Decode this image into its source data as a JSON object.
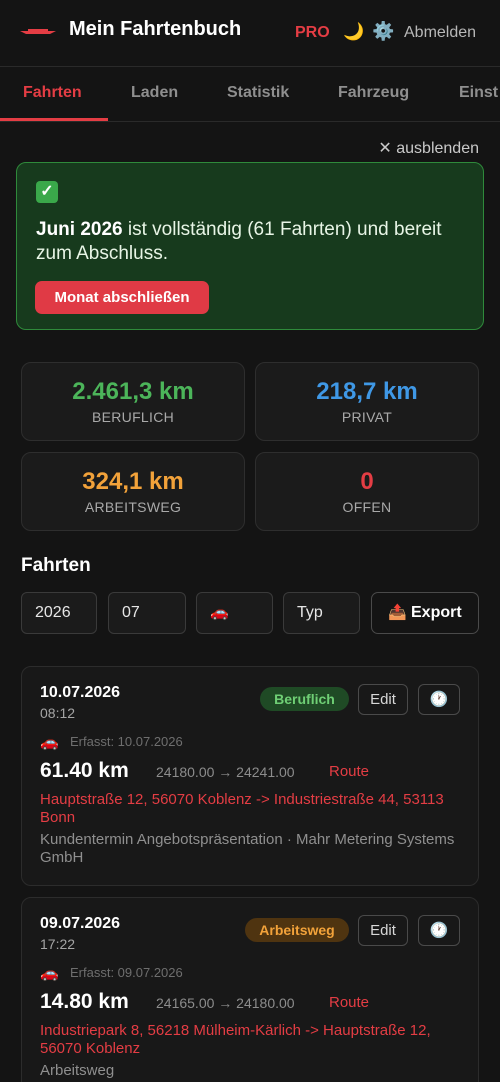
{
  "header": {
    "title": "Mein Fahrtenbuch",
    "pro": "PRO",
    "theme_icon": "moon-icon",
    "settings_icon": "gear-icon",
    "logout": "Abmelden",
    "brand_color": "#e43d44"
  },
  "tabs": [
    {
      "label": "Fahrten",
      "active": true
    },
    {
      "label": "Laden"
    },
    {
      "label": "Statistik"
    },
    {
      "label": "Fahrzeug"
    },
    {
      "label": "Einst"
    }
  ],
  "banner": {
    "hide": "✕ ausblenden",
    "check": "✓",
    "month": "Juni 2026",
    "message": " ist vollständig (61 Fahrten) und bereit zum Abschluss.",
    "button": "Monat abschließen"
  },
  "stats": [
    {
      "value": "2.461,3 km",
      "label": "BERUFLICH",
      "color": "#4cb55a"
    },
    {
      "value": "218,7 km",
      "label": "PRIVAT",
      "color": "#3f98e6"
    },
    {
      "value": "324,1 km",
      "label": "ARBEITSWEG",
      "color": "#f2a23a"
    },
    {
      "value": "0",
      "label": "OFFEN",
      "color": "#e43d44"
    }
  ],
  "trips_section": {
    "title": "Fahrten",
    "filters": {
      "year": "2026",
      "month": "07",
      "vehicle_icon": "car-icon",
      "type": "Typ"
    },
    "export": "Export"
  },
  "trips": [
    {
      "date": "10.07.2026",
      "time": "08:12",
      "type": "Beruflich",
      "edit": "Edit",
      "recorded": "Erfasst: 10.07.2026",
      "km": "61.40 km",
      "odometer": "24180.00 → 24241.00",
      "route_link": "Route",
      "route": "Hauptstraße 12, 56070 Koblenz -> Industriestraße 44, 53113 Bonn",
      "purpose": "Kundentermin Angebotspräsentation · Mahr Metering Systems GmbH"
    },
    {
      "date": "09.07.2026",
      "time": "17:22",
      "type": "Arbeitsweg",
      "edit": "Edit",
      "recorded": "Erfasst: 09.07.2026",
      "km": "14.80 km",
      "odometer": "24165.00 → 24180.00",
      "route_link": "Route",
      "route": "Industriepark 8, 56218 Mülheim-Kärlich -> Hauptstraße 12, 56070 Koblenz",
      "purpose": "Arbeitsweg"
    }
  ]
}
